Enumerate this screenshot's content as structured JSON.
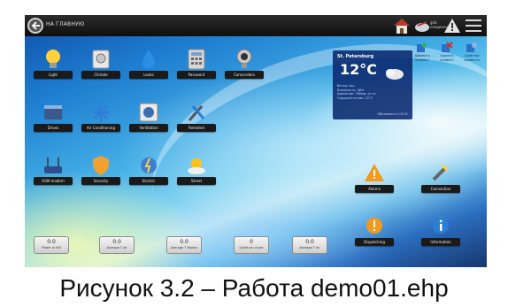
{
  "topbar": {
    "home_label": "НА ГЛАВНУЮ",
    "user_label_line1": "gnb",
    "user_label_line2": "соединения"
  },
  "tiles": [
    {
      "label": "Light",
      "icon": "lightbulb-icon"
    },
    {
      "label": "Climate",
      "icon": "thermostat-icon"
    },
    {
      "label": "Leaks",
      "icon": "water-drop-icon"
    },
    {
      "label": "Password",
      "icon": "keypad-icon"
    },
    {
      "label": "Camcorders",
      "icon": "webcam-icon"
    },
    {
      "label": "Drives",
      "icon": "drive-icon"
    },
    {
      "label": "Air Conditioning",
      "icon": "snowflake-icon"
    },
    {
      "label": "Ventilation",
      "icon": "fan-icon"
    },
    {
      "label": "Remoted",
      "icon": "remote-tools-icon"
    },
    {
      "label": "GSM modem",
      "icon": "router-icon"
    },
    {
      "label": "Security",
      "icon": "shield-icon"
    },
    {
      "label": "Electric",
      "icon": "electric-globe-icon"
    },
    {
      "label": "Street",
      "icon": "sun-cloud-icon"
    },
    {
      "label": "Alarms",
      "icon": "warning-icon"
    },
    {
      "label": "Connection",
      "icon": "plug-icon"
    },
    {
      "label": "Dispatching",
      "icon": "bell-alert-icon"
    },
    {
      "label": "Information",
      "icon": "info-icon"
    }
  ],
  "weather": {
    "city": "St. Petersburg",
    "temperature": "12°C",
    "line1": "Ветер: Asc.",
    "line2": "Влажность: 48%",
    "line3": "Давление: 760мм. рт.ст",
    "line4": "Ощущается как: 12°С",
    "updated": "Обновлено в 13:21"
  },
  "actions": [
    {
      "label1": "Добавить",
      "label2": "элемент",
      "icon": "add-element-icon"
    },
    {
      "label1": "Удалить",
      "label2": "элемент",
      "icon": "delete-element-icon"
    },
    {
      "label1": "Свойства",
      "label2": "элемента",
      "icon": "properties-icon"
    }
  ],
  "sensors": [
    {
      "value": "0.0",
      "caption": "Power in kW"
    },
    {
      "value": "0.0",
      "caption": "Average T air"
    },
    {
      "value": "0.0",
      "caption": "Average T Rooms"
    },
    {
      "value": "0",
      "caption": "Lights on count"
    },
    {
      "value": "0.0",
      "caption": "Average T air"
    }
  ],
  "caption": "Рисунок 3.2 – Работа demo01.ehp",
  "colors": {
    "topbar": "#1a1a1a",
    "label_bg": "#1a1a1a",
    "weather_bg": "#0a286e",
    "accent_blue": "#1f7fd1"
  }
}
